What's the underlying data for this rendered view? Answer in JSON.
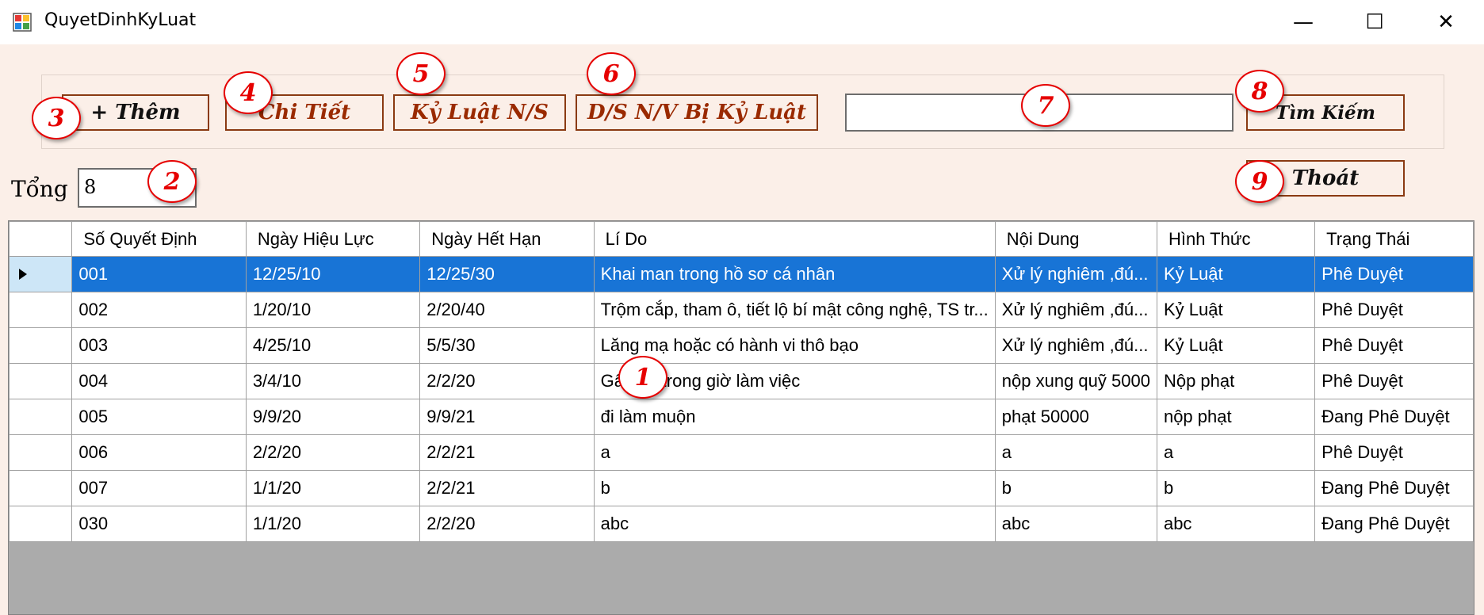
{
  "window": {
    "title": "QuyetDinhKyLuat",
    "minimize_glyph": "—",
    "maximize_glyph": "☐",
    "close_glyph": "✕"
  },
  "toolbar": {
    "add_label": "+ Thêm",
    "detail_label": "Chi Tiết",
    "discipline_label": "Kỷ Luật N/S",
    "list_label": "D/S N/V Bị Kỷ Luật",
    "search_value": "",
    "search_label": "Tìm Kiếm",
    "exit_label": "Thoát"
  },
  "total": {
    "label": "Tổng",
    "value": "8"
  },
  "grid": {
    "columns": [
      "Số Quyết Định",
      "Ngày Hiệu Lực",
      "Ngày Hết Hạn",
      "Lí Do",
      "Nội Dung",
      "Hình Thức",
      "Trạng Thái"
    ],
    "selected_row": 0,
    "rows": [
      [
        "001",
        "12/25/10",
        "12/25/30",
        "Khai man trong hồ sơ cá nhân",
        "Xử lý nghiêm ,đú...",
        "Kỷ Luật",
        "Phê Duyệt"
      ],
      [
        "002",
        "1/20/10",
        "2/20/40",
        "Trộm cắp, tham ô, tiết lộ bí mật công nghệ, TS tr...",
        "Xử lý nghiêm ,đú...",
        "Kỷ Luật",
        "Phê Duyệt"
      ],
      [
        "003",
        "4/25/10",
        "5/5/30",
        "Lăng mạ hoặc có hành vi thô bạo",
        "Xử lý nghiêm ,đú...",
        "Kỷ Luật",
        "Phê Duyệt"
      ],
      [
        "004",
        "3/4/10",
        "2/2/20",
        "Gây rối trong giờ làm việc",
        "nộp xung quỹ 5000",
        "Nộp phạt",
        "Phê Duyệt"
      ],
      [
        "005",
        "9/9/20",
        "9/9/21",
        "đi làm muộn",
        "phạt 50000",
        "nộp phạt",
        "Đang Phê Duyệt"
      ],
      [
        "006",
        "2/2/20",
        "2/2/21",
        "a",
        "a",
        "a",
        "Phê Duyệt"
      ],
      [
        "007",
        "1/1/20",
        "2/2/21",
        "b",
        "b",
        "b",
        "Đang Phê Duyệt"
      ],
      [
        "030",
        "1/1/20",
        "2/2/20",
        "abc",
        "abc",
        "abc",
        "Đang Phê Duyệt"
      ]
    ]
  },
  "callouts": [
    "1",
    "2",
    "3",
    "4",
    "5",
    "6",
    "7",
    "8",
    "9"
  ],
  "colors": {
    "form_background": "#fbefe8",
    "button_border": "#8a3a12",
    "button_text": "#9a2a00",
    "selection": "#1874d6",
    "callout": "#e60000",
    "grid_empty": "#ababab"
  }
}
